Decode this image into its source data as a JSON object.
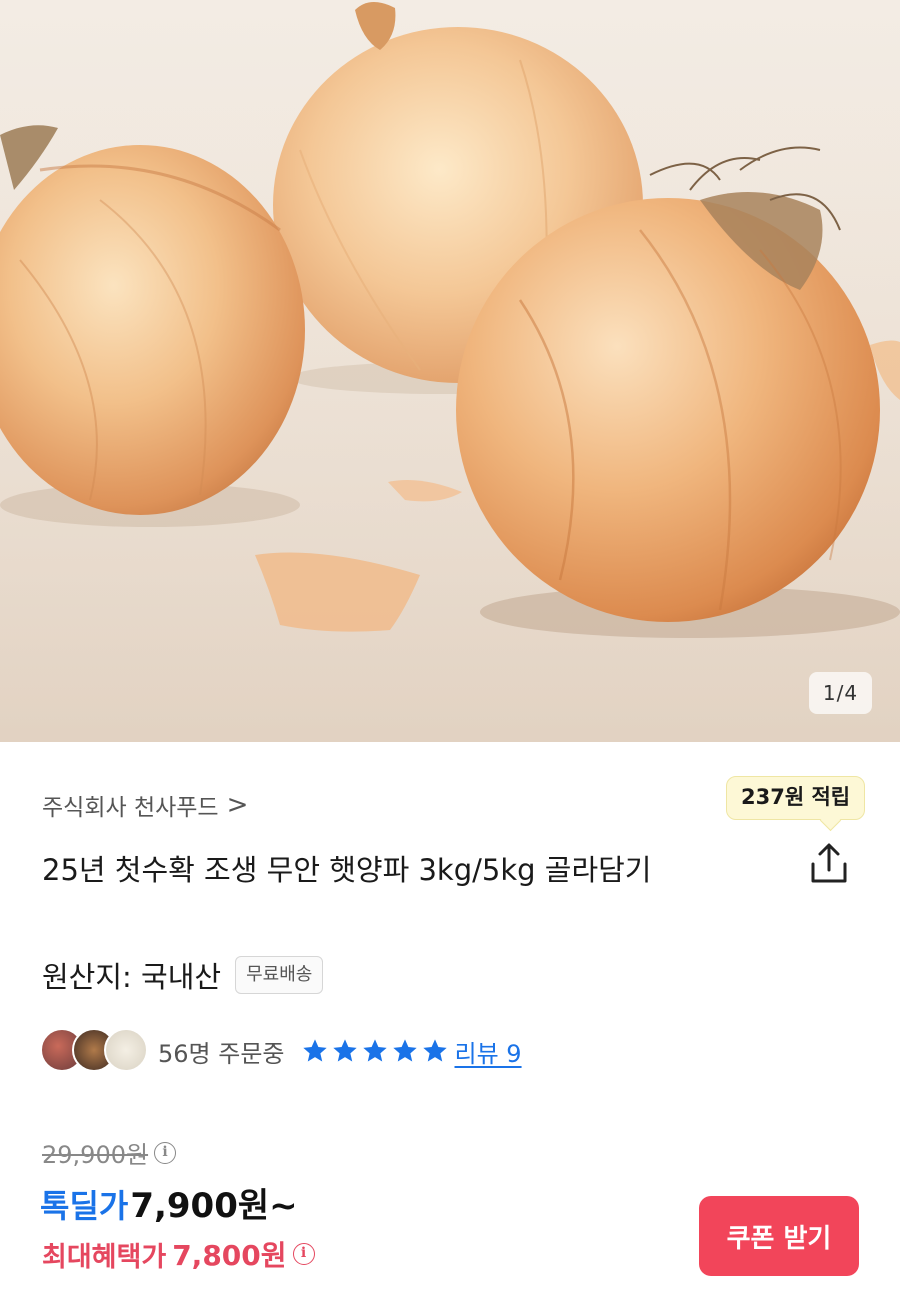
{
  "gallery": {
    "image_alt": "onions product photo",
    "page_indicator": "1/4"
  },
  "seller": {
    "name": "주식회사 천사푸드",
    "chevron": ">"
  },
  "points": {
    "label": "237원 적립"
  },
  "share": {
    "icon": "share-icon"
  },
  "product": {
    "title": "25년 첫수확 조생 무안 햇양파 3kg/5kg 골라담기",
    "origin": "원산지: 국내산",
    "shipping_tag": "무료배송"
  },
  "social": {
    "order_count": "56명 주문중",
    "rating_stars": 5,
    "review_link": "리뷰 9"
  },
  "pricing": {
    "original_price": "29,900원",
    "deal_label": "톡딜가",
    "deal_price": "7,900원~",
    "max_benefit_label": "최대혜택가",
    "max_benefit_price": "7,800원",
    "info_symbol": "i"
  },
  "coupon": {
    "button_label": "쿠폰 받기"
  },
  "colors": {
    "accent_blue": "#1a73e8",
    "accent_red": "#e5475f",
    "coupon_bg": "#f2455a",
    "points_bg": "#fdf8d6"
  }
}
